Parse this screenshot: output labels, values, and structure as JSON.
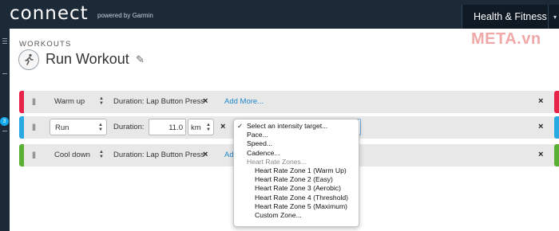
{
  "app": {
    "logo_text": "connect",
    "powered_by": "powered by Garmin",
    "nav_button": "Health & Fitness",
    "watermark": "META.vn"
  },
  "sidebar": {
    "badge": "3"
  },
  "header": {
    "breadcrumb": "WORKOUTS",
    "title": "Run Workout"
  },
  "steps": [
    {
      "type": "Warm up",
      "duration": "Duration: Lap Button Press",
      "link": "Add More...",
      "accent": "#e8234a"
    },
    {
      "type": "Run",
      "duration_label": "Duration:",
      "duration_value": "11.0",
      "unit": "km",
      "accent": "#29a9e1"
    },
    {
      "type": "Cool down",
      "duration": "Duration: Lap Button Press",
      "link": "Ad",
      "accent": "#5ab033"
    }
  ],
  "intensity_dropdown": {
    "options": [
      {
        "label": "Select an intensity target...",
        "selected": true
      },
      {
        "label": "Pace..."
      },
      {
        "label": "Speed..."
      },
      {
        "label": "Cadence..."
      },
      {
        "label": "Heart Rate Zones...",
        "group": true
      },
      {
        "label": "Heart Rate Zone 1 (Warm Up)",
        "sub": true
      },
      {
        "label": "Heart Rate Zone 2 (Easy)",
        "sub": true
      },
      {
        "label": "Heart Rate Zone 3 (Aerobic)",
        "sub": true
      },
      {
        "label": "Heart Rate Zone 4 (Threshold)",
        "sub": true
      },
      {
        "label": "Heart Rate Zone 5 (Maximum)",
        "sub": true
      },
      {
        "label": "Custom Zone...",
        "sub": true
      }
    ]
  },
  "colors": {
    "topbar": "#1c2a38",
    "link": "#1f86c8",
    "warmup": "#e8234a",
    "run": "#29a9e1",
    "cooldown": "#5ab033"
  }
}
